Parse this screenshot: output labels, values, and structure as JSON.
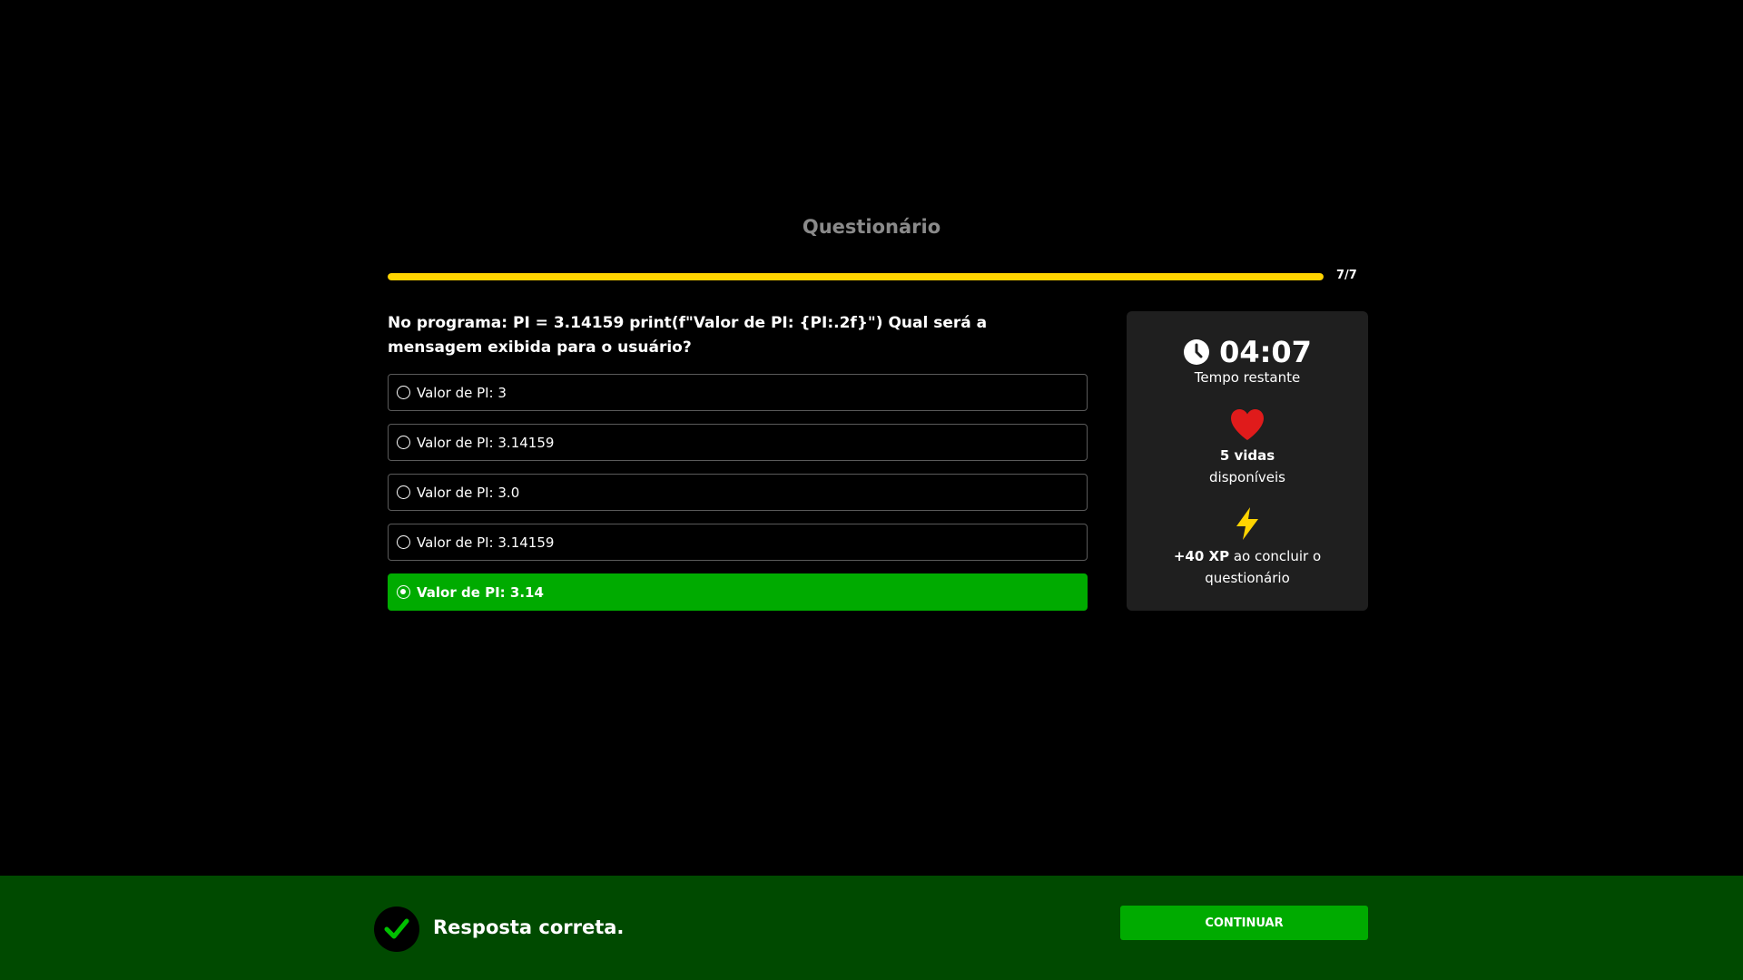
{
  "quiz": {
    "title": "Questionário",
    "progress": {
      "current": 7,
      "total": 7,
      "label": "7/7",
      "fraction": 1.0
    },
    "question": "No programa: PI = 3.14159 print(f\"Valor de PI: {PI:.2f}\") Qual será a mensagem exibida para o usuário?",
    "options": [
      {
        "label": "Valor de PI: 3",
        "selected": false
      },
      {
        "label": "Valor de PI: 3.14159",
        "selected": false
      },
      {
        "label": "Valor de PI: 3.0",
        "selected": false
      },
      {
        "label": "Valor de PI: 3.14159",
        "selected": false
      },
      {
        "label": "Valor de PI: 3.14",
        "selected": true
      }
    ]
  },
  "stats": {
    "timer": {
      "value": "04:07",
      "label": "Tempo restante",
      "icon": "clock-icon"
    },
    "lives": {
      "count": "5 vidas",
      "label": "disponíveis",
      "icon": "heart-icon"
    },
    "xp": {
      "amount": "+40 XP",
      "label": "ao concluir o questionário",
      "icon": "bolt-icon"
    }
  },
  "feedback": {
    "message": "Resposta correta.",
    "icon": "check-icon",
    "continue_label": "CONTINUAR"
  },
  "colors": {
    "background": "#000000",
    "accent_yellow": "#ffd400",
    "success_green": "#00ab00",
    "feedback_bar": "#004a00",
    "card": "#1f1f1f",
    "heart": "#e01b1b"
  }
}
